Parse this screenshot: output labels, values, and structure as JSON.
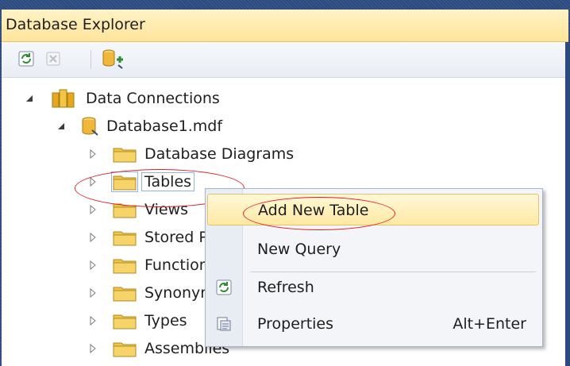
{
  "window": {
    "title": "Database Explorer"
  },
  "toolbar": {
    "buttons": [
      {
        "icon": "refresh-icon",
        "enabled": true
      },
      {
        "icon": "stop-icon",
        "enabled": false
      },
      {
        "icon": "connect-to-database-icon",
        "enabled": true
      }
    ]
  },
  "tree": {
    "root": {
      "label": "Data Connections",
      "icon": "data-connections-icon",
      "expanded": true
    },
    "database": {
      "label": "Database1.mdf",
      "icon": "database-file-icon",
      "expanded": true
    },
    "nodes": [
      {
        "label": "Database Diagrams"
      },
      {
        "label": "Tables"
      },
      {
        "label": "Views"
      },
      {
        "label": "Stored Procedures"
      },
      {
        "label": "Functions"
      },
      {
        "label": "Synonyms"
      },
      {
        "label": "Types"
      },
      {
        "label": "Assemblies"
      }
    ]
  },
  "context_menu": {
    "items": [
      {
        "label": "Add New Table",
        "highlighted": true
      },
      {
        "label": "New Query"
      },
      {
        "label": "Refresh",
        "icon": "refresh-icon"
      },
      {
        "label": "Properties",
        "icon": "properties-icon",
        "shortcut": "Alt+Enter"
      }
    ]
  },
  "colors": {
    "title_bar": "#ffe49a",
    "highlight": "#ffe9a3",
    "annotation": "#e0202a",
    "folder": "#f2c545"
  }
}
